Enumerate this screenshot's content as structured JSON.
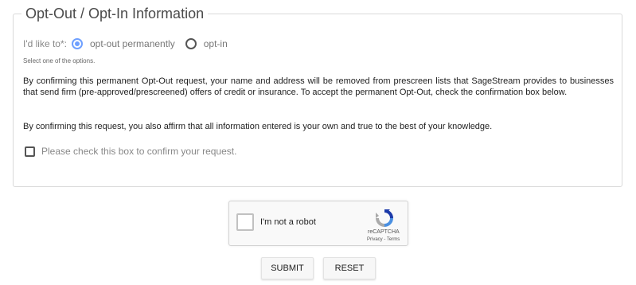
{
  "form": {
    "legend": "Opt-Out / Opt-In Information",
    "prompt": "I'd like to*:",
    "options": [
      {
        "label": "opt-out permanently",
        "checked": true
      },
      {
        "label": "opt-in",
        "checked": false
      }
    ],
    "helper": "Select one of the options.",
    "paragraph1": "By confirming this permanent Opt-Out request, your name and address will be removed from prescreen lists that SageStream provides to businesses that send firm (pre-approved/prescreened) offers of credit or insurance. To accept the permanent Opt-Out, check the confirmation box below.",
    "paragraph2": "By confirming this request, you also affirm that all information entered is your own and true to the best of your knowledge.",
    "confirm_label": "Please check this box to confirm your request."
  },
  "recaptcha": {
    "label": "I'm not a robot",
    "brand": "reCAPTCHA",
    "privacy": "Privacy",
    "terms": "Terms"
  },
  "buttons": {
    "submit": "SUBMIT",
    "reset": "RESET"
  },
  "colors": {
    "radio_accent": "#6fa0ff"
  }
}
